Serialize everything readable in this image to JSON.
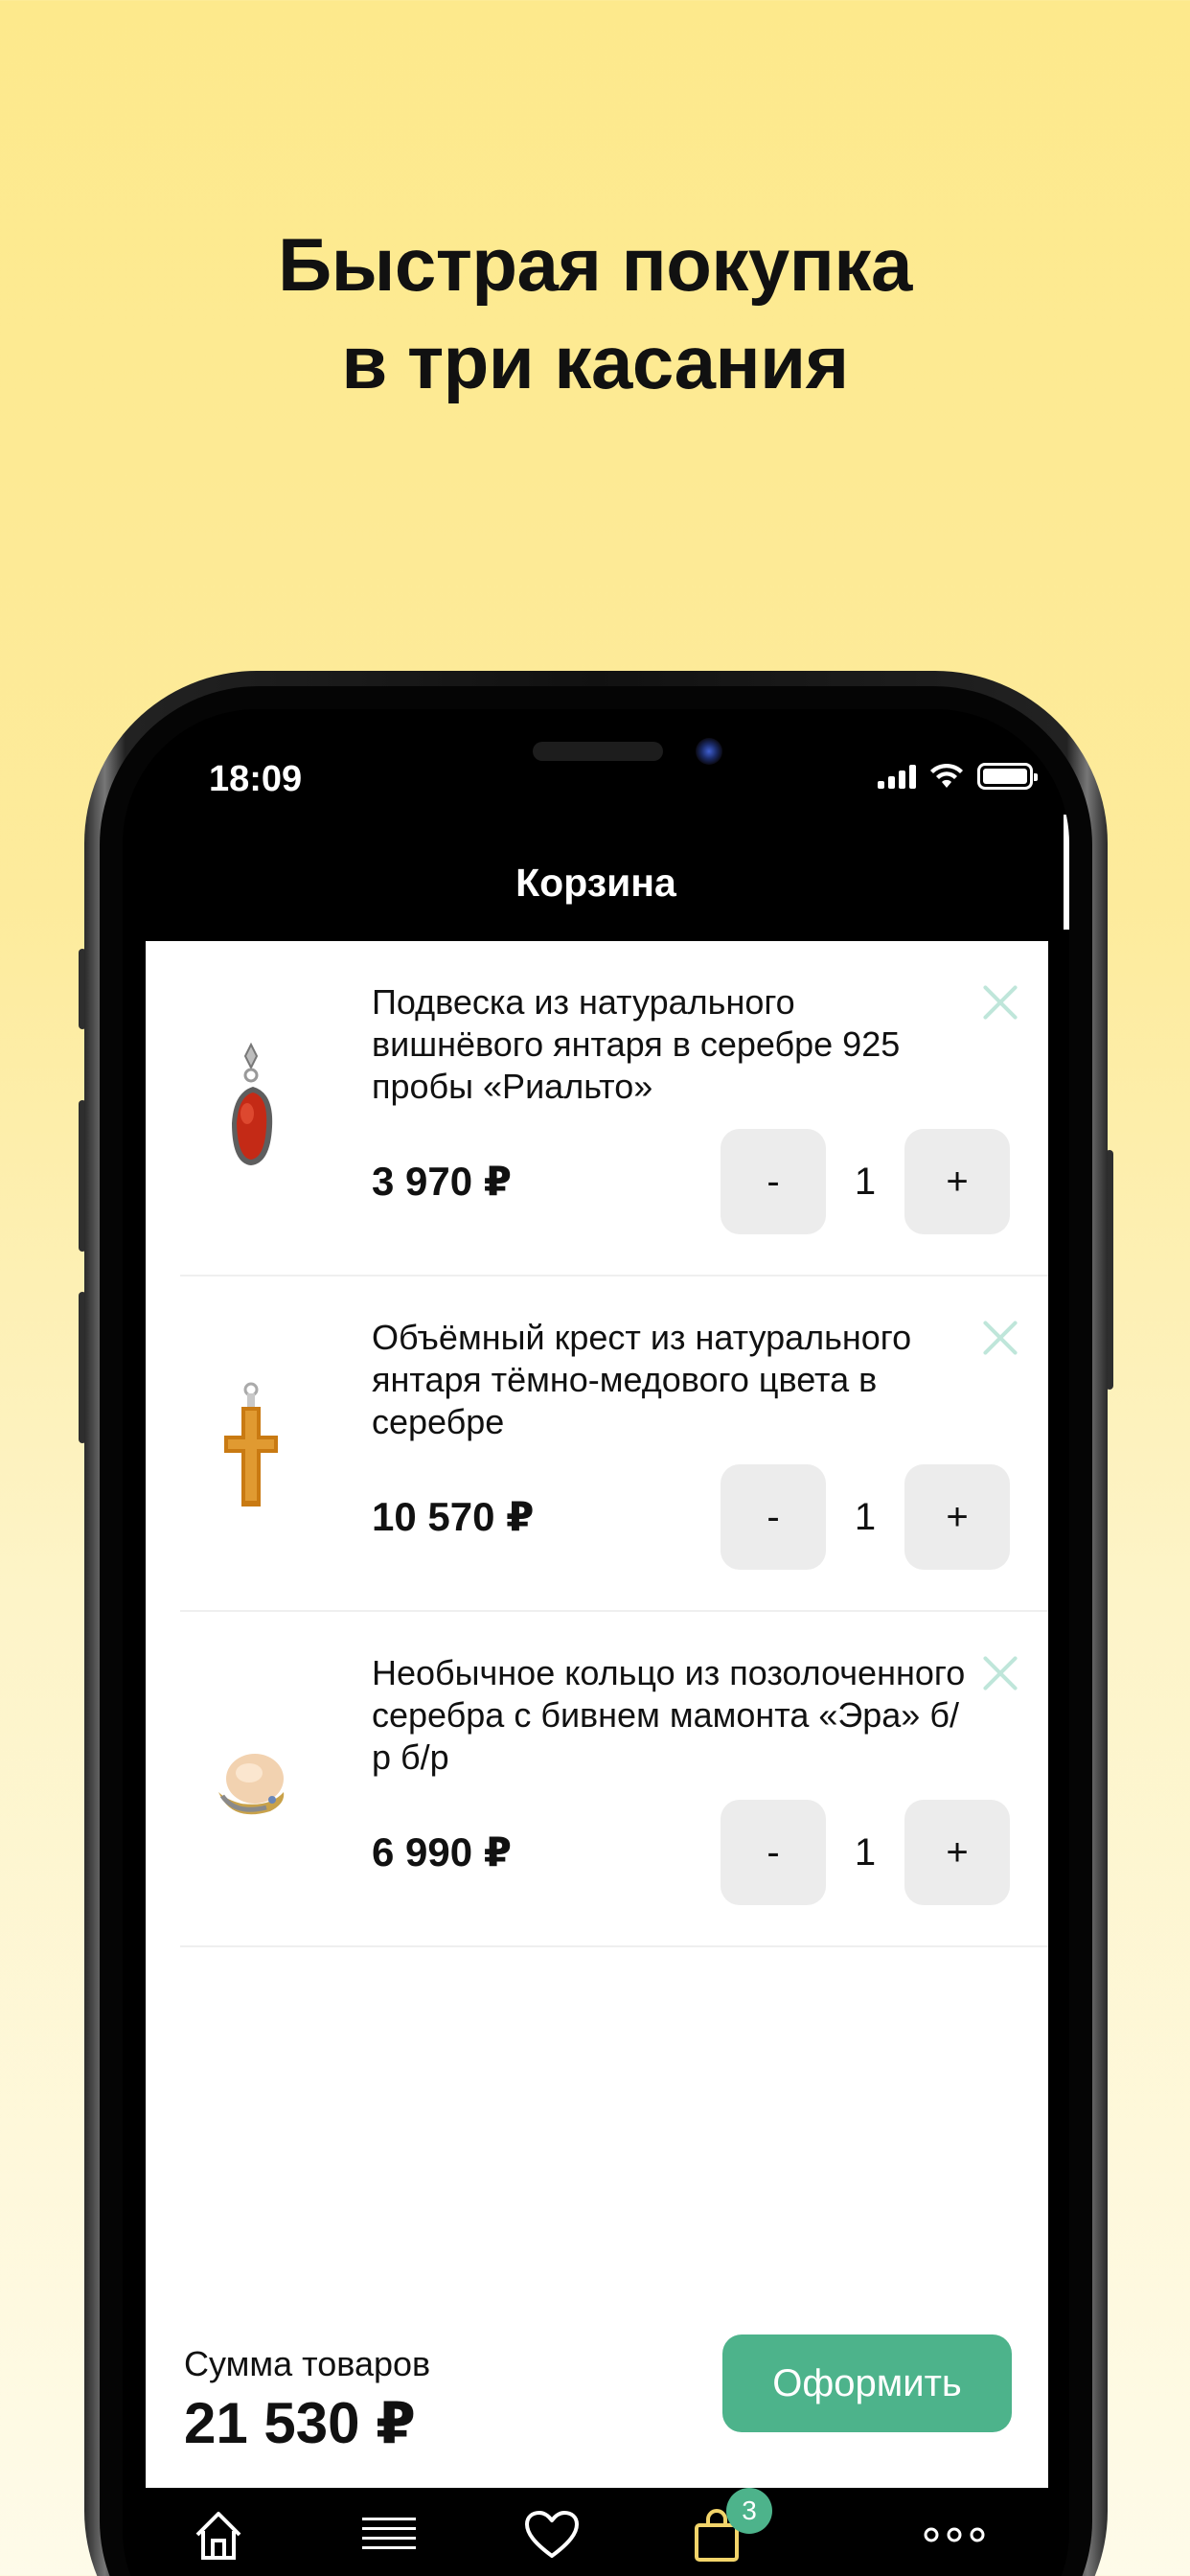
{
  "promo": {
    "line1": "Быстрая покупка",
    "line2": "в три касания"
  },
  "status_bar": {
    "time": "18:09",
    "icons": [
      "cellular-signal-icon",
      "wifi-icon",
      "battery-icon"
    ]
  },
  "nav": {
    "title": "Корзина"
  },
  "cart": {
    "items": [
      {
        "title": "Подвеска из натурального вишнёвого янтаря в серебре 925 пробы «Риальто»",
        "price": "3 970 ₽",
        "quantity": "1",
        "thumb": "amber-pendant-icon"
      },
      {
        "title": "Объёмный крест из натурального янтаря тёмно-медового цвета в серебре",
        "price": "10 570 ₽",
        "quantity": "1",
        "thumb": "amber-cross-icon"
      },
      {
        "title": "Необычное кольцо из позолоченного серебра с бивнем мамонта «Эра» б/р б/р",
        "price": "6 990 ₽",
        "quantity": "1",
        "thumb": "mammoth-ring-icon"
      }
    ],
    "minus_label": "-",
    "plus_label": "+"
  },
  "summary": {
    "label": "Сумма товаров",
    "total": "21 530 ₽",
    "checkout_label": "Оформить"
  },
  "tabbar": {
    "items": [
      "home-icon",
      "menu-icon",
      "heart-icon",
      "bag-icon",
      "more-icon"
    ],
    "cart_badge": "3"
  },
  "colors": {
    "accent": "#4db38b",
    "background_top": "#fde98c",
    "background_bottom": "#fefbe9",
    "remove_icon": "#bfe6da"
  }
}
